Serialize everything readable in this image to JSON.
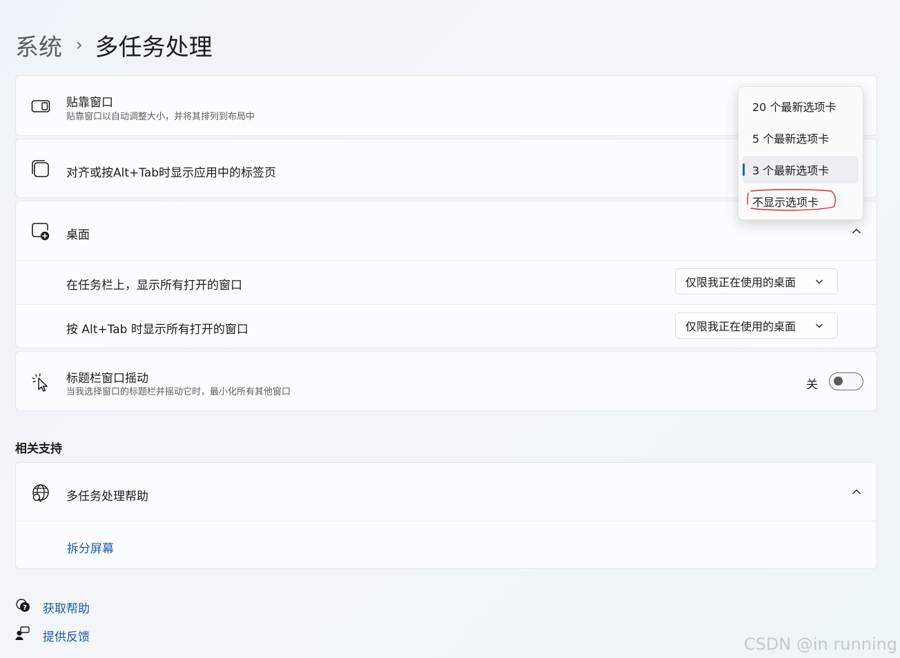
{
  "breadcrumb": {
    "parent": "系统",
    "separator": "›",
    "current": "多任务处理"
  },
  "snap_windows": {
    "title": "贴靠窗口",
    "subtitle": "贴靠窗口以自动调整大小，并将其排列到布局中",
    "icon": "snap-layout-icon"
  },
  "tabs_setting": {
    "title": "对齐或按Alt+Tab时显示应用中的标签页",
    "icon": "app-tabs-icon"
  },
  "tabs_dropdown": {
    "options": [
      "20 个最新选项卡",
      "5 个最新选项卡",
      "3 个最新选项卡",
      "不显示选项卡"
    ],
    "selected": "3 个最新选项卡",
    "annotated": "不显示选项卡",
    "annotation_color": "#e0262a"
  },
  "desktops": {
    "title": "桌面",
    "icon": "add-desktop-icon",
    "expander": "chevron-up-icon",
    "rows": [
      {
        "label": "在任务栏上，显示所有打开的窗口",
        "value": "仅限我正在使用的桌面"
      },
      {
        "label": "按 Alt+Tab 时显示所有打开的窗口",
        "value": "仅限我正在使用的桌面"
      }
    ]
  },
  "title_bar_shake": {
    "title": "标题栏窗口摇动",
    "subtitle": "当我选择窗口的标题栏并摇动它时，最小化所有其他窗口",
    "icon": "shake-cursor-icon",
    "state_label": "关",
    "on": false
  },
  "related": {
    "heading": "相关支持",
    "help_title": "多任务处理帮助",
    "help_icon": "globe-help-icon",
    "link": "拆分屏幕"
  },
  "footer": {
    "get_help": "获取帮助",
    "feedback": "提供反馈"
  },
  "watermark": "CSDN @in   running",
  "colors": {
    "accent": "#1d6b86",
    "link": "#1a5cab"
  }
}
